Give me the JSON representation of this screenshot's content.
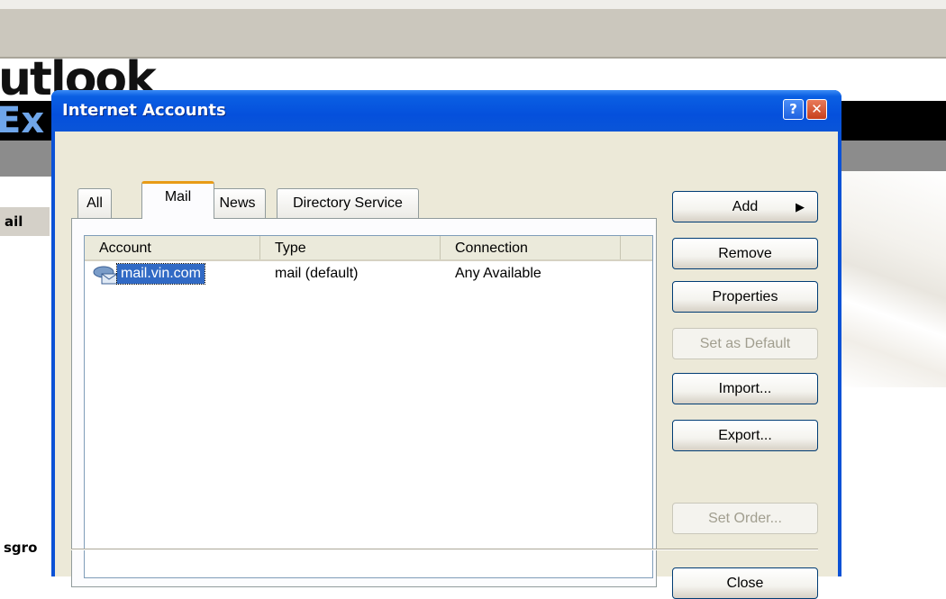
{
  "background_app": {
    "logo_text": "utlook",
    "logo_text_2": "Ex",
    "sidebar_mail": "ail",
    "sidebar_newsgroups": "sgro"
  },
  "dialog": {
    "title": "Internet Accounts",
    "help_glyph": "?",
    "close_glyph": "✕"
  },
  "tabs": {
    "all": "All",
    "mail": "Mail",
    "news": "News",
    "directory": "Directory Service",
    "selected": "Mail"
  },
  "list": {
    "columns": [
      "Account",
      "Type",
      "Connection"
    ],
    "rows": [
      {
        "account": "mail.vin.com",
        "type": "mail (default)",
        "connection": "Any Available",
        "icon": "mail-account-icon",
        "selected": true
      }
    ]
  },
  "buttons": {
    "add": "Add",
    "remove": "Remove",
    "properties": "Properties",
    "set_default": "Set as Default",
    "import": "Import...",
    "export": "Export...",
    "set_order": "Set Order...",
    "close": "Close"
  },
  "colors": {
    "titlebar": "#0550dc",
    "selection": "#316ac5",
    "tab_accent": "#e89b17",
    "dialog_face": "#ece9d8"
  }
}
